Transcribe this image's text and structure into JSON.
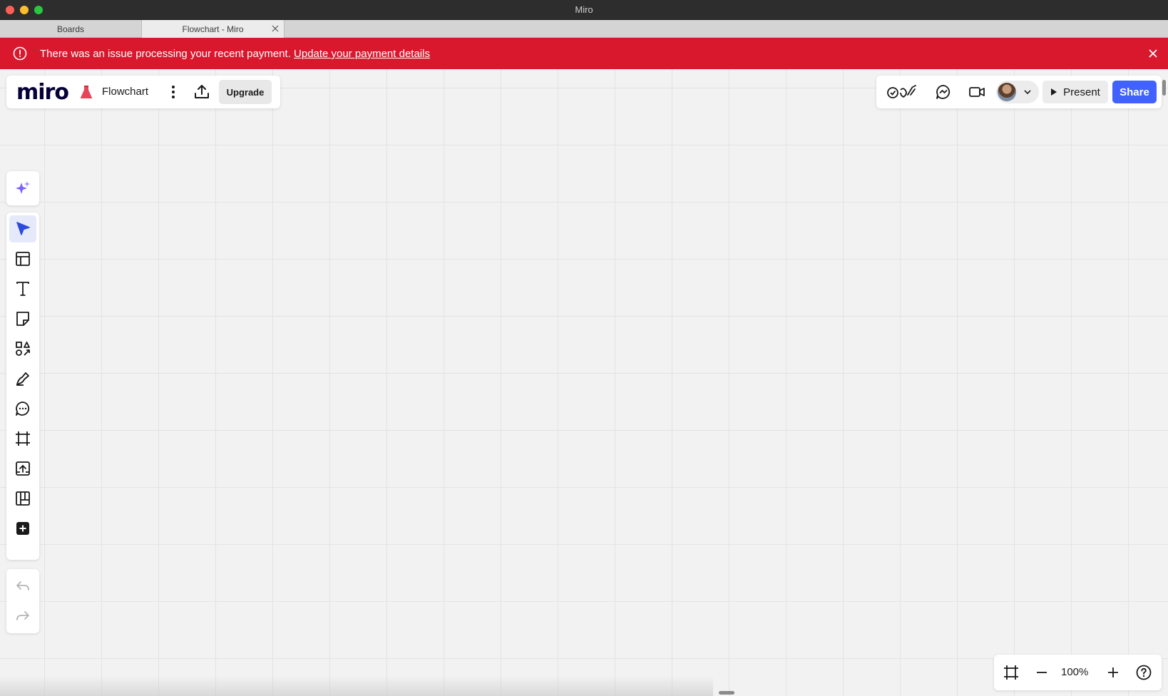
{
  "window": {
    "title": "Miro"
  },
  "tabs": [
    {
      "label": "Boards"
    },
    {
      "label": "Flowchart - Miro"
    }
  ],
  "alert": {
    "message": "There was an issue processing your recent payment.",
    "link_text": "Update your payment details",
    "color": "#d9182e"
  },
  "board": {
    "logo": "miro",
    "name": "Flowchart",
    "upgrade_label": "Upgrade"
  },
  "collab": {
    "present_label": "Present",
    "share_label": "Share",
    "share_color": "#4262ff"
  },
  "toolbar": {
    "tools": [
      "select-tool",
      "templates-tool",
      "text-tool",
      "sticky-note-tool",
      "shapes-tool",
      "pen-tool",
      "comment-tool",
      "frame-tool",
      "upload-tool",
      "kanban-tool",
      "more-apps-tool"
    ],
    "active_tool": "select-tool",
    "accent": "#4262ff"
  },
  "zoom": {
    "value": "100%"
  }
}
